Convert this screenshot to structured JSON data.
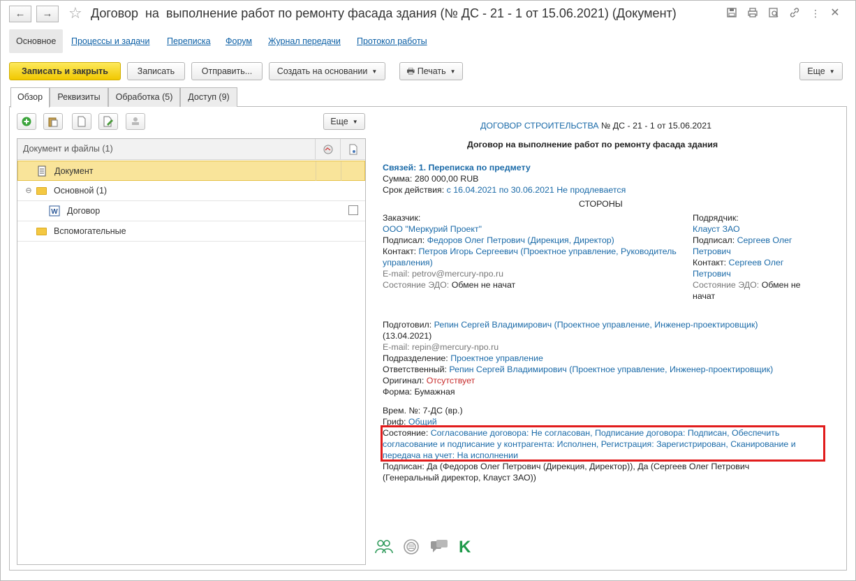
{
  "window": {
    "title": "Договор  на  выполнение работ по ремонту фасада здания (№ ДС - 21 - 1 от 15.06.2021) (Документ)",
    "back_label": "←",
    "forward_label": "→",
    "star": "☆"
  },
  "title_icons": [
    "save-icon",
    "print-icon",
    "preview-icon",
    "link-icon",
    "more-vertical-icon",
    "close-icon"
  ],
  "sections": [
    "Основное",
    "Процессы и задачи",
    "Переписка",
    "Форум",
    "Журнал передачи",
    "Протокол работы"
  ],
  "toolbar": {
    "save_close": "Записать и закрыть",
    "save": "Записать",
    "send": "Отправить...",
    "create_based": "Создать на основании",
    "print": "Печать",
    "more": "Еще",
    "caret": "▼"
  },
  "tabs": [
    "Обзор",
    "Реквизиты",
    "Обработка (5)",
    "Доступ (9)"
  ],
  "left_toolbar": {
    "more": "Еще",
    "buttons": [
      "add-icon",
      "paste-icon",
      "new-document-icon",
      "edit-icon",
      "stamp-icon"
    ]
  },
  "grid": {
    "header": "Документ и файлы (1)",
    "rows": [
      {
        "label": "Документ",
        "type": "document",
        "selected": true
      },
      {
        "label": "Основной (1)",
        "type": "folder",
        "expanded": true
      },
      {
        "label": "Договор",
        "type": "word-file"
      },
      {
        "label": "Вспомогательные",
        "type": "folder"
      }
    ]
  },
  "preview": {
    "header_link": "ДОГОВОР СТРОИТЕЛЬСТВА",
    "header_num": " № ДС - 21 - 1 от 15.06.2021",
    "subject": "Договор на выполнение работ по ремонту фасада здания",
    "links": "Связей: 1. Переписка по предмету",
    "sum_label": "Сумма: ",
    "sum_value": "280 000,00 RUB",
    "term_label": "Срок действия: ",
    "term_value": "с 16.04.2021 по 30.06.2021 Не продлевается",
    "parties": "СТОРОНЫ",
    "customer_label": "Заказчик:",
    "customer_name": "ООО \"Меркурий Проект\"",
    "customer_signed_label": "Подписал: ",
    "customer_signed": "Федоров Олег Петрович (Дирекция, Директор)",
    "customer_contact_label": "Контакт: ",
    "customer_contact_1": "Петров Игорь Сергеевич (Проектное управление, Руководитель",
    "customer_contact_2": "управления)",
    "customer_email": "E-mail: petrov@mercury-npo.ru",
    "customer_edo_label": "Состояние ЭДО: ",
    "customer_edo": "Обмен не начат",
    "contractor_label": "Подрядчик:",
    "contractor_name": "Клауст ЗАО",
    "contractor_signed_label": "Подписал: ",
    "contractor_signed_1": "Сергеев Олег",
    "contractor_signed_2": "Петрович",
    "contractor_contact_label": "Контакт: ",
    "contractor_contact_1": "Сергеев Олег",
    "contractor_contact_2": "Петрович",
    "contractor_edo_label": "Состояние ЭДО: ",
    "contractor_edo_1": "Обмен не",
    "contractor_edo_2": "начат",
    "prepared_label": "Подготовил: ",
    "prepared": "Репин Сергей Владимирович (Проектное управление, Инженер-проектировщик)",
    "prepared_date": "(13.04.2021)",
    "prepared_email": "E-mail: repin@mercury-npo.ru",
    "division_label": "Подразделение: ",
    "division": "Проектное управление",
    "responsible_label": "Ответственный: ",
    "responsible": "Репин Сергей Владимирович (Проектное управление, Инженер-проектировщик)",
    "original_label": "Оригинал: ",
    "original": "Отсутствует",
    "form_label": "Форма: ",
    "form": "Бумажная",
    "temp_no_label": "Врем. №: ",
    "temp_no": "7-ДС (вр.)",
    "grif_label": "Гриф: ",
    "grif": "Общий",
    "state_label": "Состояние: ",
    "state_1": "Согласование договора: Не согласован, Подписание договора: Подписан, Обеспечить",
    "state_2": "согласование и подписание у контрагента: Исполнен, Регистрация: Зарегистрирован, Сканирование и",
    "state_3": "передача на учет: На исполнении",
    "signed_1": "Подписан: Да (Федоров Олег Петрович (Дирекция, Директор)), Да (Сергеев Олег Петрович",
    "signed_2": "(Генеральный директор, Клауст ЗАО))"
  },
  "bottom_icons": [
    "participants-icon",
    "discussion-icon",
    "chat-icon",
    "k-icon"
  ],
  "colors": {
    "accent": "#f1c800",
    "link": "#1a6aa8",
    "highlight": "#e11c1c",
    "selected_row": "#f9e49a"
  }
}
